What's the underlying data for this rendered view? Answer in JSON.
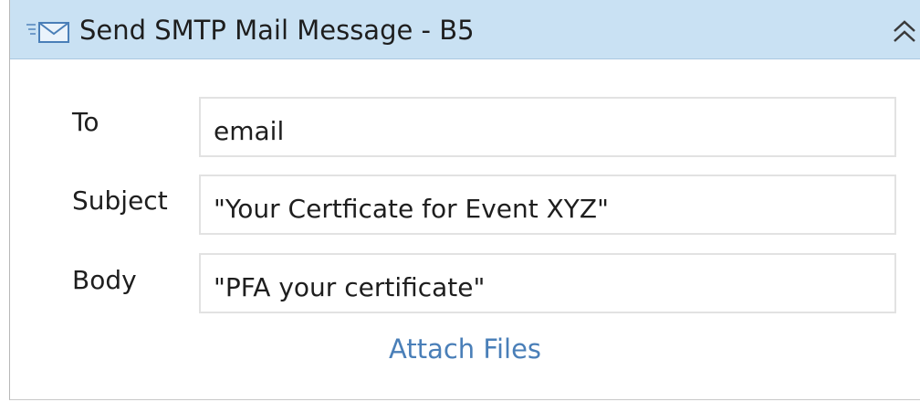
{
  "activity": {
    "title": "Send SMTP Mail Message - B5",
    "icons": {
      "header": "mail-icon",
      "collapse": "double-chevron-up-icon"
    },
    "colors": {
      "header_background": "#c9e1f3",
      "link": "#4a7fb8"
    }
  },
  "fields": {
    "to": {
      "label": "To",
      "value": "email"
    },
    "subject": {
      "label": "Subject",
      "value": "\"Your Certficate for Event XYZ\""
    },
    "body": {
      "label": "Body",
      "value": "\"PFA your certificate\""
    }
  },
  "attach_link": "Attach Files"
}
